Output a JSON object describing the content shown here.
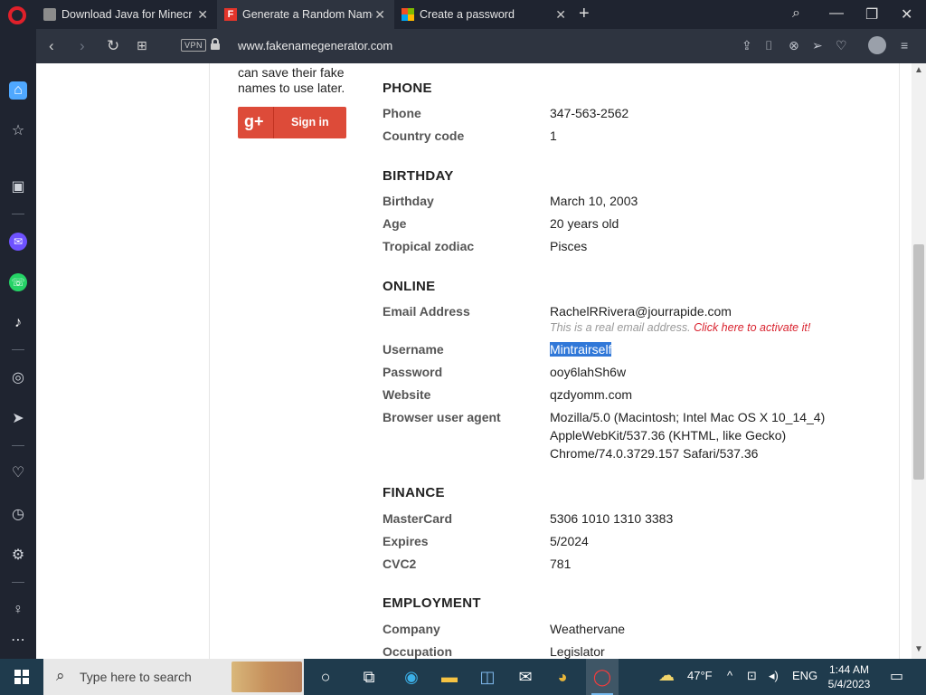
{
  "browser": {
    "tabs": [
      {
        "label": "Download Java for Minecraft",
        "close": "✕",
        "active": false
      },
      {
        "label": "Generate a Random Name",
        "close": "✕",
        "active": true
      },
      {
        "label": "Create a password",
        "close": "✕",
        "active": false
      }
    ],
    "new_tab": "+",
    "vpn_label": "VPN",
    "url": "www.fakenamegenerator.com"
  },
  "left_panel": {
    "promo_text": "can save their fake names to use later.",
    "google_sign_in": "Sign in",
    "google_glyph": "g+"
  },
  "sections": {
    "phone": {
      "heading": "PHONE",
      "rows": [
        {
          "label": "Phone",
          "value": "347-563-2562"
        },
        {
          "label": "Country code",
          "value": "1"
        }
      ]
    },
    "birthday": {
      "heading": "BIRTHDAY",
      "rows": [
        {
          "label": "Birthday",
          "value": "March 10, 2003"
        },
        {
          "label": "Age",
          "value": "20 years old"
        },
        {
          "label": "Tropical zodiac",
          "value": "Pisces"
        }
      ]
    },
    "online": {
      "heading": "ONLINE",
      "email_label": "Email Address",
      "email_value": "RachelRRivera@jourrapide.com",
      "email_note": "This is a real email address.",
      "email_activate": "Click here to activate it!",
      "username_label": "Username",
      "username_value": "Mintrairself",
      "password_label": "Password",
      "password_value": "ooy6lahSh6w",
      "website_label": "Website",
      "website_value": "qzdyomm.com",
      "ua_label": "Browser user agent",
      "ua_line1": "Mozilla/5.0 (Macintosh; Intel Mac OS X 10_14_4)",
      "ua_line2": "AppleWebKit/537.36 (KHTML, like Gecko)",
      "ua_line3": "Chrome/74.0.3729.157 Safari/537.36"
    },
    "finance": {
      "heading": "FINANCE",
      "rows": [
        {
          "label": "MasterCard",
          "value": "5306 1010 1310 3383"
        },
        {
          "label": "Expires",
          "value": "5/2024"
        },
        {
          "label": "CVC2",
          "value": "781"
        }
      ]
    },
    "employment": {
      "heading": "EMPLOYMENT",
      "rows": [
        {
          "label": "Company",
          "value": "Weathervane"
        },
        {
          "label": "Occupation",
          "value": "Legislator"
        }
      ]
    }
  },
  "taskbar": {
    "search_placeholder": "Type here to search",
    "weather": "47°F",
    "language": "ENG",
    "time": "1:44 AM",
    "date": "5/4/2023"
  }
}
